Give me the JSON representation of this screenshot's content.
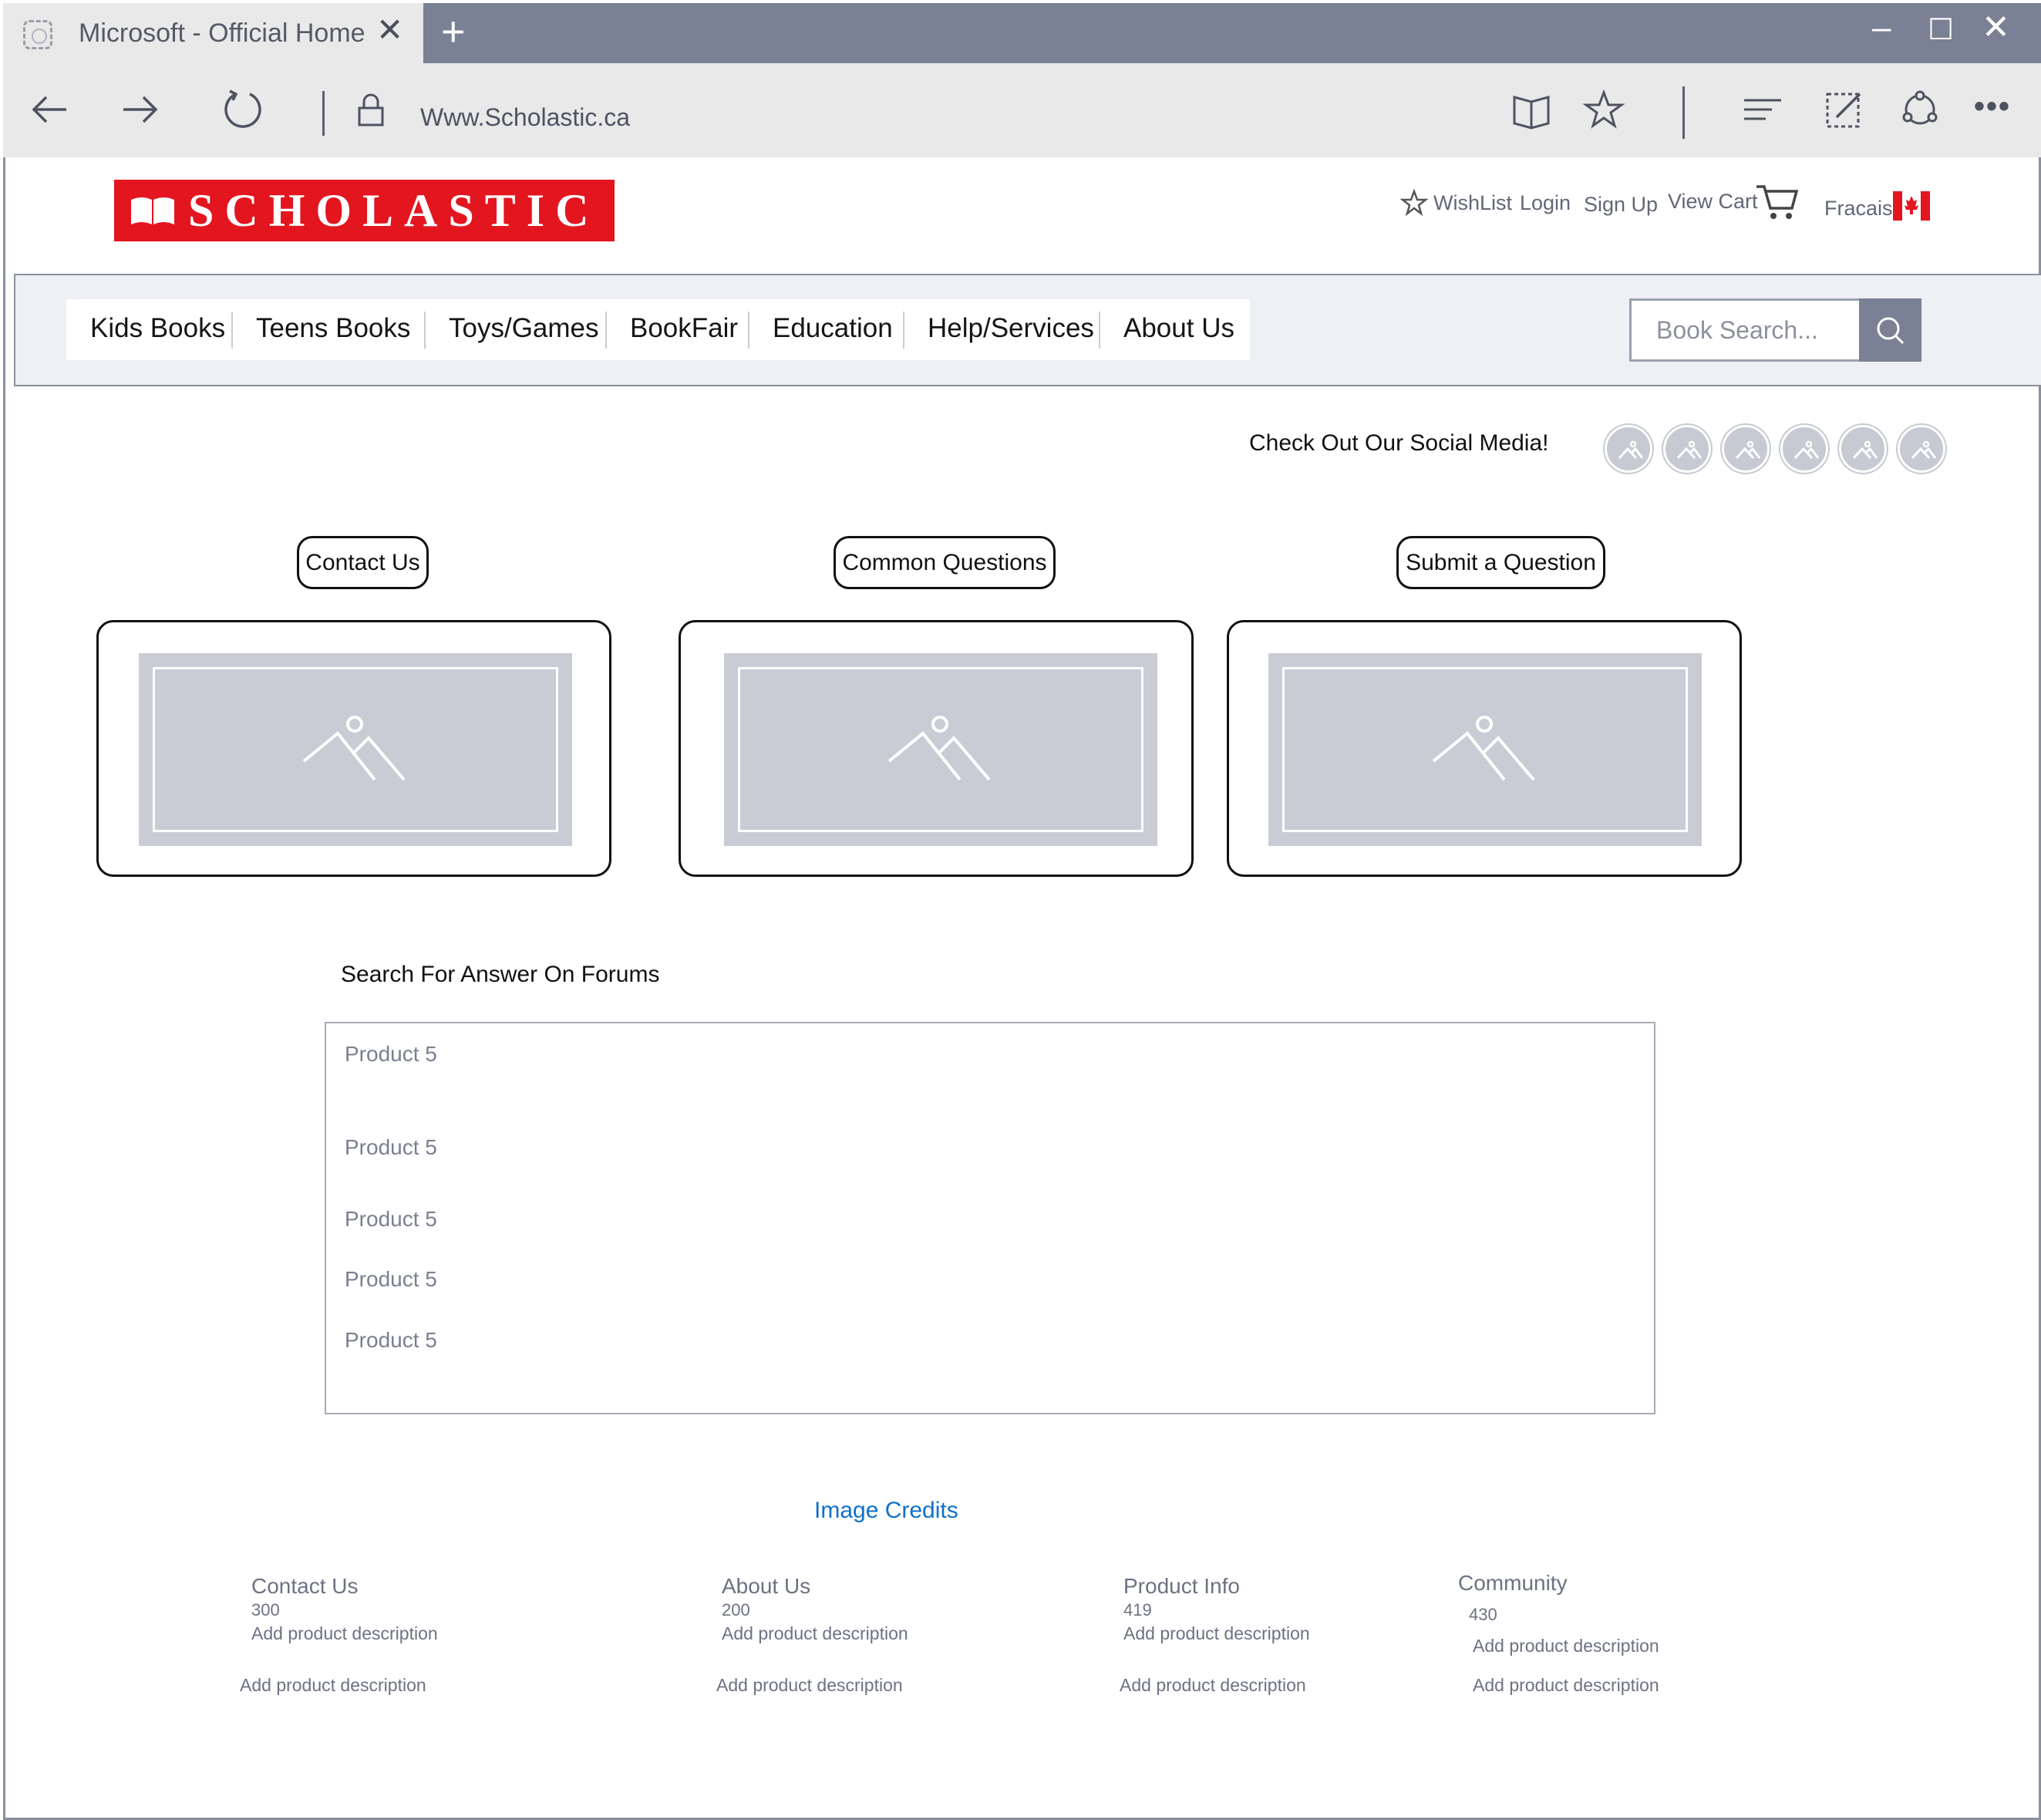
{
  "browser": {
    "tab_title": "Microsoft  - Official Home",
    "tab_close": "✕",
    "new_tab": "+",
    "window_controls": [
      "–",
      "☐",
      "✕"
    ],
    "url": "Www.Scholastic.ca",
    "more": "•••"
  },
  "header": {
    "logo_text": "SCHOLASTIC",
    "links": {
      "wishlist": "WishList",
      "login": "Login",
      "signup": "Sign Up",
      "view_cart": "View Cart",
      "language": "Fracais"
    }
  },
  "nav": {
    "items": [
      "Kids Books",
      "Teens Books",
      "Toys/Games",
      "BookFair",
      "Education",
      "Help/Services",
      "About Us"
    ],
    "search_placeholder": "Book Search..."
  },
  "social": {
    "label": "Check Out Our Social Media!"
  },
  "actions": {
    "contact": "Contact Us",
    "questions": "Common Questions",
    "submit": "Submit a Question"
  },
  "forum": {
    "title": "Search For Answer On Forums",
    "items": [
      "Product 5",
      "Product 5",
      "Product 5",
      "Product 5",
      "Product 5"
    ]
  },
  "footer": {
    "credits": "Image Credits",
    "columns": [
      {
        "title": "Contact Us",
        "number": "300",
        "desc1": "Add product description",
        "desc2": "Add product description"
      },
      {
        "title": "About Us",
        "number": "200",
        "desc1": "Add product description",
        "desc2": "Add product description"
      },
      {
        "title": "Product Info",
        "number": "419",
        "desc1": "Add product description",
        "desc2": "Add product description"
      },
      {
        "title": "Community",
        "number": "430",
        "desc1": "Add product description",
        "desc2": "Add product description"
      }
    ]
  },
  "colors": {
    "brand_red": "#e3151f",
    "chrome_gray": "#7b8194",
    "link_blue": "#1070c8"
  }
}
